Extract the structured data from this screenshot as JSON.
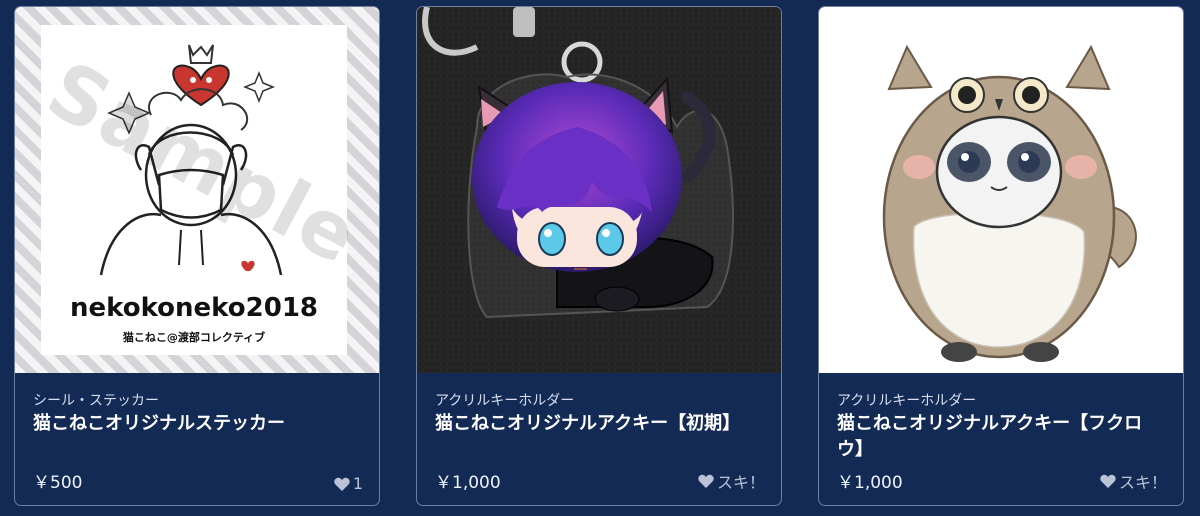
{
  "products": [
    {
      "category": "シール・ステッカー",
      "title": "猫こねこオリジナルステッカー",
      "price": "￥500",
      "like_label": "1",
      "image": {
        "watermark": "Sample",
        "name_text": "nekokoneko2018",
        "sub_text": "猫こねこ@渡部コレクティブ"
      }
    },
    {
      "category": "アクリルキーホルダー",
      "title": "猫こねこオリジナルアクキー【初期】",
      "price": "￥1,000",
      "like_label": "スキ！"
    },
    {
      "category": "アクリルキーホルダー",
      "title": "猫こねこオリジナルアクキー【フクロウ】",
      "price": "￥1,000",
      "like_label": "スキ！"
    }
  ],
  "colors": {
    "background": "#132a55",
    "card_border": "#6f7f9f",
    "heart": "#b9c2d6"
  }
}
